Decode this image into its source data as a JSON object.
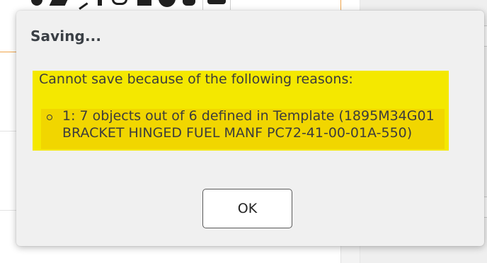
{
  "dialog": {
    "title": "Saving...",
    "error_heading": "Cannot save because of the following reasons:",
    "errors": [
      "1: 7 objects out of 6 defined in Template (1895M34G01 BRACKET HINGED FUEL MANF PC72-41-00-01A-550)"
    ],
    "ok_label": "OK"
  },
  "colors": {
    "highlight": "#f4e800",
    "item_highlight": "#f1d600",
    "accent": "#f0a44a"
  },
  "icons": [
    "shield-icon",
    "tag-icon",
    "wand-icon",
    "pin-icon",
    "paperclip-icon",
    "bar-chart-icon",
    "info-icon",
    "database-icon",
    "more-icon"
  ]
}
